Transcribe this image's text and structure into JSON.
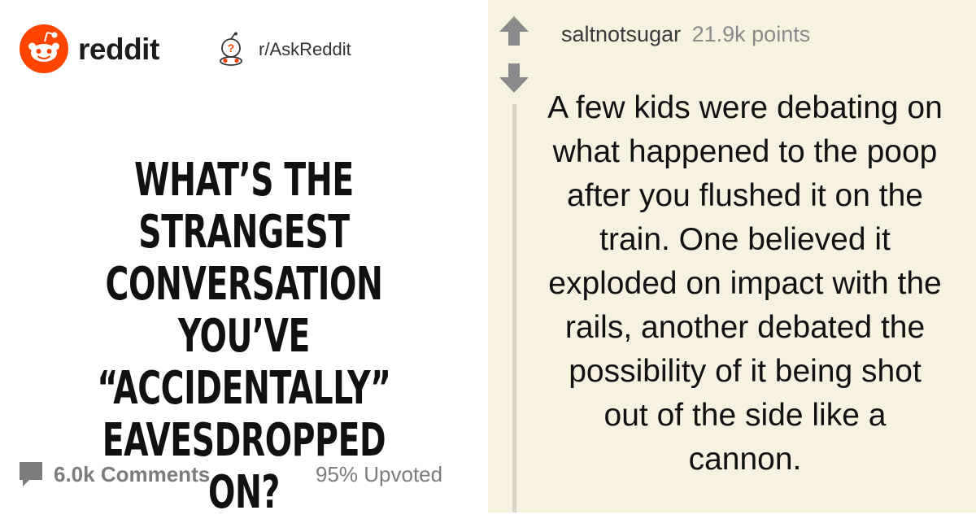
{
  "brand": {
    "name": "reddit",
    "accent": "#ff4500"
  },
  "subreddit": {
    "name": "r/AskReddit"
  },
  "post": {
    "title": "What’s the strangest conversation you’ve “accidentally” eavesdropped on?",
    "comments_label": "6.0k Comments",
    "upvoted_label": "95% Upvoted"
  },
  "comment": {
    "author": "saltnotsugar",
    "points": "21.9k points",
    "body": "A few kids were debating on what happened to the poop after you flushed it on the train. One believed it exploded on impact with the rails, another debated the possibility of it being shot out of the side like a cannon."
  },
  "icons": {
    "brand": "reddit-snoo-icon",
    "subreddit": "askreddit-snoo-icon",
    "comments": "comment-bubble-icon",
    "upvote": "upvote-arrow-icon",
    "downvote": "downvote-arrow-icon"
  },
  "colors": {
    "comment_panel_background": "#f7f1e1",
    "muted_text": "#7c7c7c",
    "vote_arrow": "#8a8a8a"
  }
}
